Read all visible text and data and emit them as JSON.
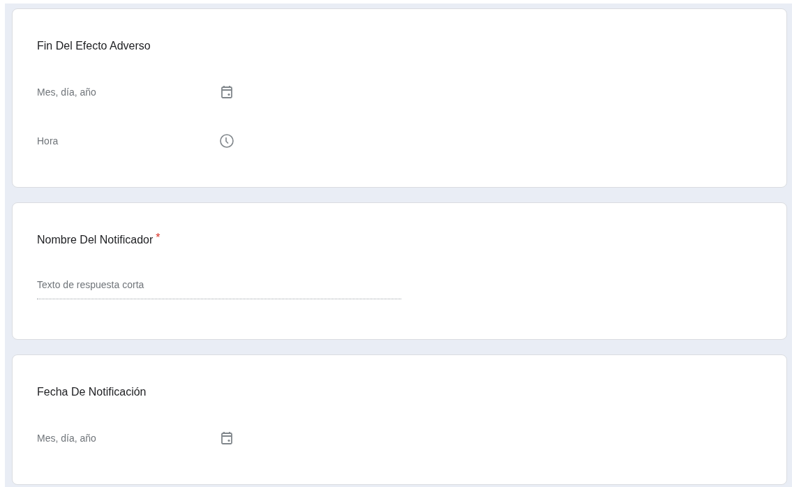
{
  "questions": [
    {
      "title": "Fin Del Efecto Adverso",
      "fields": [
        {
          "kind": "date",
          "placeholder": "Mes, día, año"
        },
        {
          "kind": "time",
          "placeholder": "Hora"
        }
      ]
    },
    {
      "title": "Nombre Del Notificador",
      "required_mark": "*",
      "fields": [
        {
          "kind": "text",
          "placeholder": "Texto de respuesta corta"
        }
      ]
    },
    {
      "title": "Fecha De Notificación",
      "fields": [
        {
          "kind": "date",
          "placeholder": "Mes, día, año"
        }
      ]
    }
  ]
}
